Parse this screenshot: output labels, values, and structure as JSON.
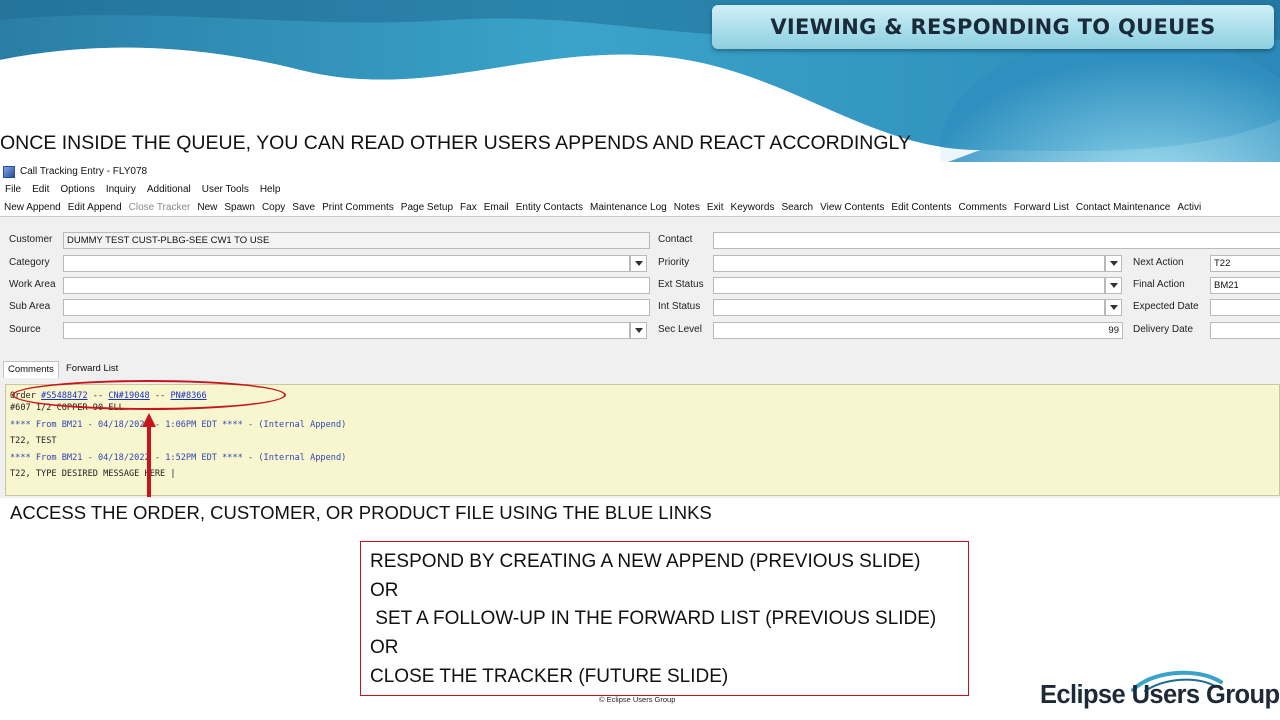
{
  "slide": {
    "title": "VIEWING & RESPONDING TO QUEUES",
    "intro": "ONCE INSIDE THE QUEUE, YOU CAN READ OTHER USERS APPENDS AND REACT ACCORDINGLY",
    "access_note": "ACCESS THE ORDER, CUSTOMER, OR PRODUCT FILE USING THE BLUE LINKS",
    "respond_lines": [
      "RESPOND BY CREATING A NEW APPEND (PREVIOUS SLIDE)",
      "OR",
      " SET A FOLLOW-UP IN THE FORWARD LIST (PREVIOUS SLIDE)",
      "OR",
      "CLOSE THE TRACKER (FUTURE SLIDE)"
    ],
    "copyright": "© Eclipse Users Group",
    "logo": "Eclipse Users Group",
    "colors": {
      "annotation": "#c8151b",
      "link": "#1a33c4",
      "comments_bg": "#f8f6cf"
    }
  },
  "window": {
    "title": "Call Tracking Entry - FLY078",
    "menu": [
      "File",
      "Edit",
      "Options",
      "Inquiry",
      "Additional",
      "User Tools",
      "Help"
    ],
    "toolbar": [
      {
        "label": "New Append",
        "enabled": true
      },
      {
        "label": "Edit Append",
        "enabled": true
      },
      {
        "label": "Close Tracker",
        "enabled": false
      },
      {
        "label": "New",
        "enabled": true
      },
      {
        "label": "Spawn",
        "enabled": true
      },
      {
        "label": "Copy",
        "enabled": true
      },
      {
        "label": "Save",
        "enabled": true
      },
      {
        "label": "Print Comments",
        "enabled": true
      },
      {
        "label": "Page Setup",
        "enabled": true
      },
      {
        "label": "Fax",
        "enabled": true
      },
      {
        "label": "Email",
        "enabled": true
      },
      {
        "label": "Entity Contacts",
        "enabled": true
      },
      {
        "label": "Maintenance Log",
        "enabled": true
      },
      {
        "label": "Notes",
        "enabled": true
      },
      {
        "label": "Exit",
        "enabled": true
      },
      {
        "label": "Keywords",
        "enabled": true
      },
      {
        "label": "Search",
        "enabled": true
      },
      {
        "label": "View Contents",
        "enabled": true
      },
      {
        "label": "Edit Contents",
        "enabled": true
      },
      {
        "label": "Comments",
        "enabled": true
      },
      {
        "label": "Forward List",
        "enabled": true
      },
      {
        "label": "Contact Maintenance",
        "enabled": true
      },
      {
        "label": "Activi",
        "enabled": true
      }
    ],
    "form": {
      "customer_label": "Customer",
      "customer_value": "DUMMY TEST CUST-PLBG-SEE CW1 TO USE",
      "category_label": "Category",
      "category_value": "",
      "work_area_label": "Work Area",
      "work_area_value": "",
      "sub_area_label": "Sub Area",
      "sub_area_value": "",
      "source_label": "Source",
      "source_value": "",
      "contact_label": "Contact",
      "contact_value": "",
      "priority_label": "Priority",
      "priority_value": "",
      "ext_status_label": "Ext Status",
      "ext_status_value": "",
      "int_status_label": "Int Status",
      "int_status_value": "",
      "sec_level_label": "Sec Level",
      "sec_level_value": "99",
      "next_action_label": "Next Action",
      "next_action_value": "T22",
      "final_action_label": "Final Action",
      "final_action_value": "BM21",
      "expected_date_label": "Expected Date",
      "expected_date_value": "",
      "delivery_date_label": "Delivery Date",
      "delivery_date_value": ""
    },
    "tabs": [
      "Comments",
      "Forward List"
    ],
    "comments": {
      "order_prefix": "Order ",
      "order_link": "#S5488472",
      "sep1": " -- ",
      "cn_link": "CN#19048",
      "sep2": " -- ",
      "pn_link": "PN#8366",
      "line2": "#607 1/2 COPPER 90 ELL",
      "append1_header": "**** From BM21 - 04/18/2022 - 1:06PM EDT **** - (Internal Append)",
      "append1_body": "T22, TEST",
      "append2_header": "**** From BM21 - 04/18/2022 - 1:52PM EDT **** - (Internal Append)",
      "append2_body": "T22, TYPE DESIRED MESSAGE HERE |"
    }
  }
}
